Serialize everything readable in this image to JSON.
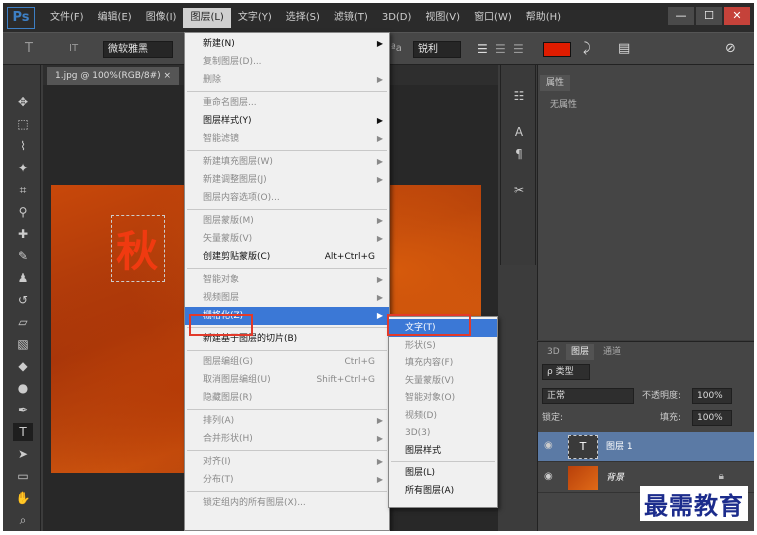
{
  "app": {
    "logo": "Ps"
  },
  "menubar": {
    "items": [
      "文件(F)",
      "编辑(E)",
      "图像(I)",
      "图层(L)",
      "文字(Y)",
      "选择(S)",
      "滤镜(T)",
      "3D(D)",
      "视图(V)",
      "窗口(W)",
      "帮助(H)"
    ],
    "active_index": 3
  },
  "window_controls": {
    "minimize": "—",
    "restore": "☐",
    "close": "✕"
  },
  "options_bar": {
    "tool_glyph": "T",
    "orient_glyph": "IT",
    "font_family": "微软雅黑",
    "aa_label": "ªa",
    "aa_value": "锐利",
    "text_color": "#e01c00"
  },
  "document": {
    "tab_label": "1.jpg @ 100%(RGB/8#) ×",
    "overlay_text": "秋"
  },
  "layer_menu": {
    "items": [
      {
        "label": "新建(N)",
        "disabled": false,
        "submenu": true
      },
      {
        "label": "复制图层(D)...",
        "disabled": true
      },
      {
        "label": "删除",
        "disabled": true,
        "submenu": true
      },
      {
        "sep": true
      },
      {
        "label": "重命名图层...",
        "disabled": true
      },
      {
        "label": "图层样式(Y)",
        "disabled": false,
        "submenu": true
      },
      {
        "label": "智能滤镜",
        "disabled": true,
        "submenu": true
      },
      {
        "sep": true
      },
      {
        "label": "新建填充图层(W)",
        "disabled": true,
        "submenu": true
      },
      {
        "label": "新建调整图层(J)",
        "disabled": true,
        "submenu": true
      },
      {
        "label": "图层内容选项(O)...",
        "disabled": true
      },
      {
        "sep": true
      },
      {
        "label": "图层蒙版(M)",
        "disabled": true,
        "submenu": true
      },
      {
        "label": "矢量蒙版(V)",
        "disabled": true,
        "submenu": true
      },
      {
        "label": "创建剪贴蒙版(C)",
        "shortcut": "Alt+Ctrl+G",
        "disabled": false
      },
      {
        "sep": true
      },
      {
        "label": "智能对象",
        "disabled": true,
        "submenu": true
      },
      {
        "label": "视频图层",
        "disabled": true,
        "submenu": true
      },
      {
        "label": "栅格化(Z)",
        "disabled": false,
        "submenu": true,
        "highlight": true
      },
      {
        "sep": true
      },
      {
        "label": "新建基于图层的切片(B)",
        "disabled": false
      },
      {
        "sep": true
      },
      {
        "label": "图层编组(G)",
        "shortcut": "Ctrl+G",
        "disabled": true
      },
      {
        "label": "取消图层编组(U)",
        "shortcut": "Shift+Ctrl+G",
        "disabled": true
      },
      {
        "label": "隐藏图层(R)",
        "disabled": true
      },
      {
        "sep": true
      },
      {
        "label": "排列(A)",
        "disabled": true,
        "submenu": true
      },
      {
        "label": "合并形状(H)",
        "disabled": true,
        "submenu": true
      },
      {
        "sep": true
      },
      {
        "label": "对齐(I)",
        "disabled": true,
        "submenu": true
      },
      {
        "label": "分布(T)",
        "disabled": true,
        "submenu": true
      },
      {
        "sep": true
      },
      {
        "label": "锁定组内的所有图层(X)...",
        "disabled": true
      }
    ]
  },
  "rasterize_submenu": {
    "items": [
      {
        "label": "文字(T)",
        "disabled": false,
        "highlight": true
      },
      {
        "label": "形状(S)",
        "disabled": true
      },
      {
        "label": "填充内容(F)",
        "disabled": true
      },
      {
        "label": "矢量蒙版(V)",
        "disabled": true
      },
      {
        "label": "智能对象(O)",
        "disabled": true
      },
      {
        "label": "视频(D)",
        "disabled": true
      },
      {
        "label": "3D(3)",
        "disabled": true
      },
      {
        "label": "图层样式",
        "disabled": false
      },
      {
        "sep": true
      },
      {
        "label": "图层(L)",
        "disabled": false
      },
      {
        "label": "所有图层(A)",
        "disabled": false
      }
    ]
  },
  "properties_panel": {
    "tab": "属性",
    "empty_text": "无属性"
  },
  "layers_panel": {
    "tabs": [
      "3D",
      "图层",
      "通道"
    ],
    "active_tab": 1,
    "filter_label": "ρ 类型",
    "blend_mode": "正常",
    "opacity_label": "不透明度:",
    "opacity_value": "100%",
    "lock_label": "锁定:",
    "fill_label": "填充:",
    "fill_value": "100%",
    "layers": [
      {
        "name": "图层 1",
        "type": "text",
        "selected": true
      },
      {
        "name": "背景",
        "type": "image",
        "selected": false,
        "locked": true
      }
    ]
  },
  "watermark": "最需教育"
}
